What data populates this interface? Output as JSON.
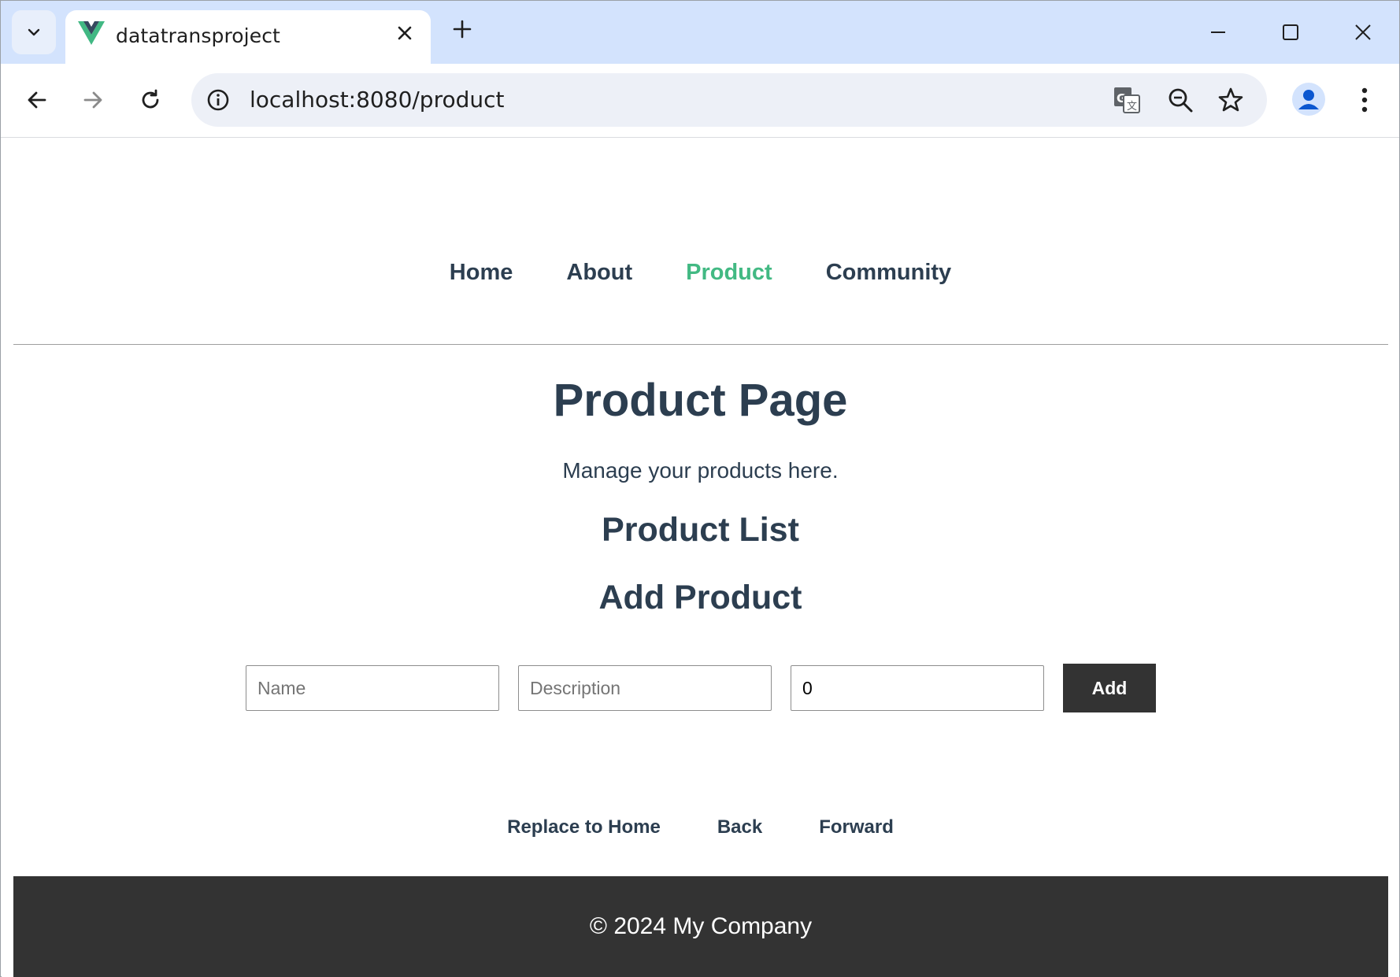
{
  "browser": {
    "tab_title": "datatransproject",
    "url": "localhost:8080/product"
  },
  "nav": {
    "items": [
      {
        "label": "Home"
      },
      {
        "label": "About"
      },
      {
        "label": "Product"
      },
      {
        "label": "Community"
      }
    ],
    "active": "Product",
    "active_color": "#42b983"
  },
  "main": {
    "title": "Product Page",
    "subtitle": "Manage your products here.",
    "list_heading": "Product List",
    "add_heading": "Add Product"
  },
  "form": {
    "name_placeholder": "Name",
    "description_placeholder": "Description",
    "price_value": "0",
    "add_label": "Add"
  },
  "route_buttons": {
    "replace_label": "Replace to Home",
    "back_label": "Back",
    "forward_label": "Forward"
  },
  "footer": {
    "text": "© 2024 My Company"
  }
}
